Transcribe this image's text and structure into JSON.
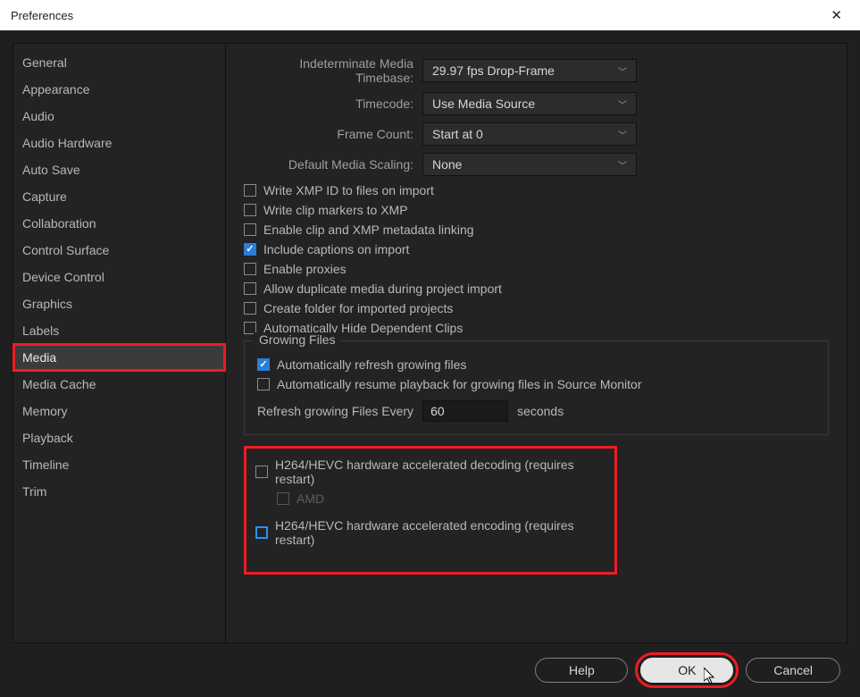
{
  "window": {
    "title": "Preferences"
  },
  "sidebar": {
    "items": [
      {
        "label": "General"
      },
      {
        "label": "Appearance"
      },
      {
        "label": "Audio"
      },
      {
        "label": "Audio Hardware"
      },
      {
        "label": "Auto Save"
      },
      {
        "label": "Capture"
      },
      {
        "label": "Collaboration"
      },
      {
        "label": "Control Surface"
      },
      {
        "label": "Device Control"
      },
      {
        "label": "Graphics"
      },
      {
        "label": "Labels"
      },
      {
        "label": "Media"
      },
      {
        "label": "Media Cache"
      },
      {
        "label": "Memory"
      },
      {
        "label": "Playback"
      },
      {
        "label": "Timeline"
      },
      {
        "label": "Trim"
      }
    ],
    "selected_index": 11
  },
  "dropdowns": {
    "indeterminate_media_timebase": {
      "label": "Indeterminate Media Timebase:",
      "value": "29.97 fps Drop-Frame"
    },
    "timecode": {
      "label": "Timecode:",
      "value": "Use Media Source"
    },
    "frame_count": {
      "label": "Frame Count:",
      "value": "Start at 0"
    },
    "default_media_scaling": {
      "label": "Default Media Scaling:",
      "value": "None"
    }
  },
  "checks": {
    "write_xmp_id": {
      "label": "Write XMP ID to files on import",
      "checked": false
    },
    "write_clip_markers": {
      "label": "Write clip markers to XMP",
      "checked": false
    },
    "enable_clip_xmp_link": {
      "label": "Enable clip and XMP metadata linking",
      "checked": false
    },
    "include_captions": {
      "label": "Include captions on import",
      "checked": true
    },
    "enable_proxies": {
      "label": "Enable proxies",
      "checked": false
    },
    "allow_duplicate": {
      "label": "Allow duplicate media during project import",
      "checked": false
    },
    "create_folder": {
      "label": "Create folder for imported projects",
      "checked": false
    },
    "auto_hide_dependent": {
      "label": "Automatically Hide Dependent Clips",
      "checked": false
    }
  },
  "growing": {
    "title": "Growing Files",
    "auto_refresh": {
      "label": "Automatically refresh growing files",
      "checked": true
    },
    "auto_resume": {
      "label": "Automatically resume playback for growing files in Source Monitor",
      "checked": false
    },
    "refresh_label": "Refresh growing Files Every",
    "refresh_value": "60",
    "refresh_suffix": "seconds"
  },
  "hw": {
    "decoding": {
      "label": "H264/HEVC hardware accelerated decoding (requires restart)",
      "checked": false
    },
    "amd": {
      "label": "AMD",
      "checked": false
    },
    "encoding": {
      "label": "H264/HEVC hardware accelerated encoding (requires restart)",
      "checked": false
    }
  },
  "buttons": {
    "help": "Help",
    "ok": "OK",
    "cancel": "Cancel"
  }
}
